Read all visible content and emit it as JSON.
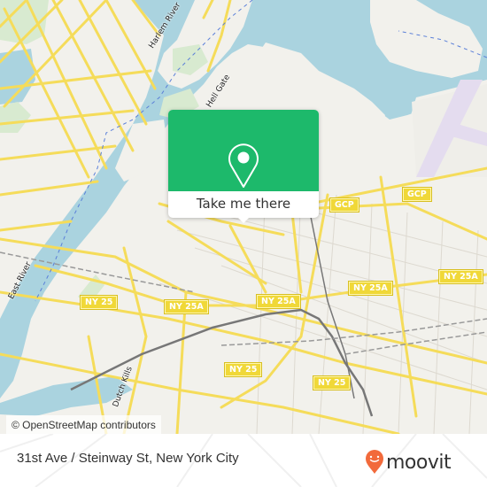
{
  "map": {
    "popup": {
      "action_label": "Take me there",
      "icon": "map-pin-icon",
      "color": "#1db96b"
    },
    "attribution": "© OpenStreetMap contributors",
    "road_shields": [
      {
        "label": "GCP"
      },
      {
        "label": "GCP"
      },
      {
        "label": "NY 25A"
      },
      {
        "label": "NY 25A"
      },
      {
        "label": "NY 25A"
      },
      {
        "label": "NY 25"
      },
      {
        "label": "NY 25"
      },
      {
        "label": "NY 25"
      }
    ],
    "water_labels": [
      {
        "label": "Harlem River"
      },
      {
        "label": "Hell Gate"
      },
      {
        "label": "East River"
      },
      {
        "label": "Dutch Kills"
      }
    ],
    "colors": {
      "land": "#f2f1ec",
      "water": "#aad3df",
      "road": "#f7df5e",
      "park": "#d8ead0",
      "airport": "#e4dcef"
    }
  },
  "footer": {
    "address": "31st Ave / Steinway St, New York City",
    "brand": "moovit",
    "brand_color": "#f26a3b"
  }
}
